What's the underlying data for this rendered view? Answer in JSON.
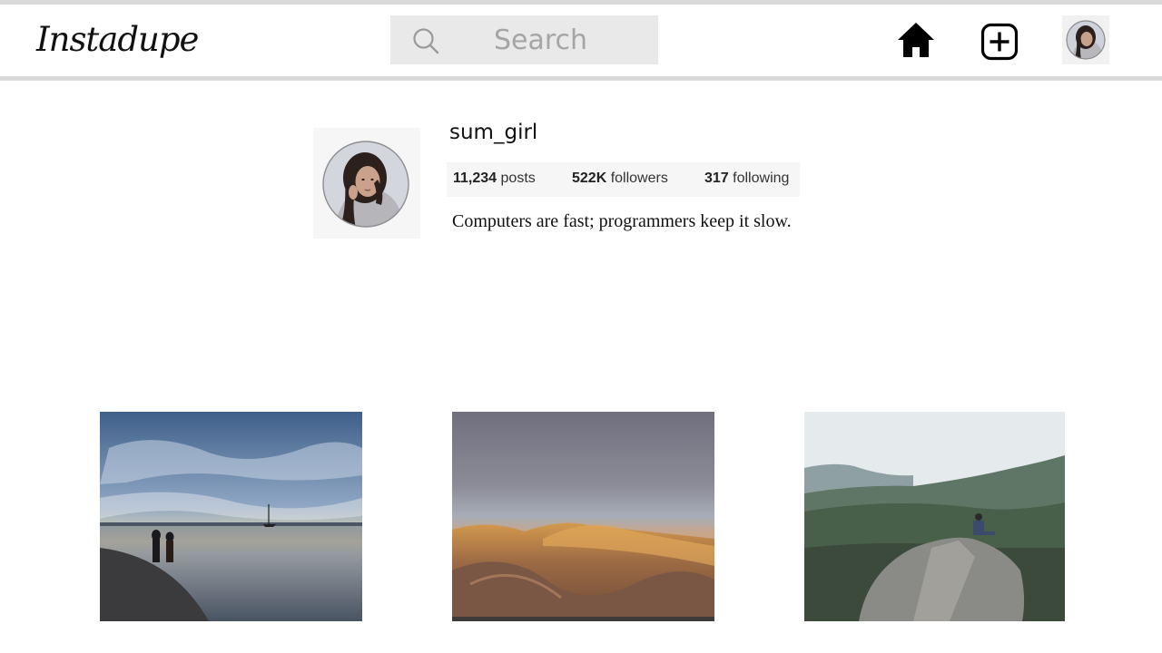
{
  "header": {
    "logo": "Instadupe",
    "search_placeholder": "Search",
    "icons": {
      "search": "search-icon",
      "home": "home-icon",
      "add": "add-post-icon",
      "avatar": "avatar"
    }
  },
  "profile": {
    "username": "sum_girl",
    "stats": {
      "posts_count": "11,234",
      "posts_label": "posts",
      "followers_count": "522K",
      "followers_label": "followers",
      "following_count": "317",
      "following_label": "following"
    },
    "bio": "Computers are fast; programmers keep it slow."
  },
  "posts": [
    {
      "subject": "couple walking on beach at sunset"
    },
    {
      "subject": "desert mountain ridge at dusk"
    },
    {
      "subject": "person sitting on rock overlooking green valley"
    }
  ],
  "colors": {
    "rule": "#d9d9d9",
    "search_bg": "#e9e9e9",
    "stats_bg": "#f6f6f6"
  }
}
